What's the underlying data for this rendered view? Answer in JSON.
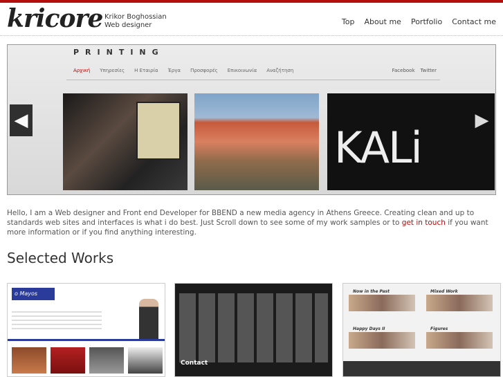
{
  "header": {
    "logo": "kricore",
    "tagline_name": "Krikor Boghossian",
    "tagline_role": "Web designer",
    "nav": [
      "Top",
      "About me",
      "Portfolio",
      "Contact me"
    ]
  },
  "slider": {
    "site_title": "PRINTING",
    "menu": [
      "Αρχική",
      "Υπηρεσίες",
      "Η Εταιρία",
      "Έργα",
      "Προσφορές",
      "Επικοινωνία",
      "Αναζήτηση"
    ],
    "social": [
      "Facebook",
      "Twitter"
    ],
    "photo_text": "KALi",
    "prev": "◀",
    "next": "▶"
  },
  "intro": {
    "text_before": "Hello, I am a Web designer and Front end Developer for BBEND a new media agency in Athens Greece. Creating clean and up to standards web sites and interfaces is what i do best. Just Scroll down to see some of my work samples or to ",
    "link": "get in touch",
    "text_after": " if you want more information or if you find anything interesting."
  },
  "works": {
    "heading": "Selected Works",
    "items": [
      {
        "brand": "o Mayos"
      },
      {
        "contact": "Contact"
      },
      {
        "labels": [
          "Now in the Past",
          "Mixed Work",
          "Happy Days II",
          "Figures"
        ]
      }
    ]
  },
  "colors": {
    "accent": "#b30d0d",
    "brand_blue": "#2b3b9c"
  }
}
